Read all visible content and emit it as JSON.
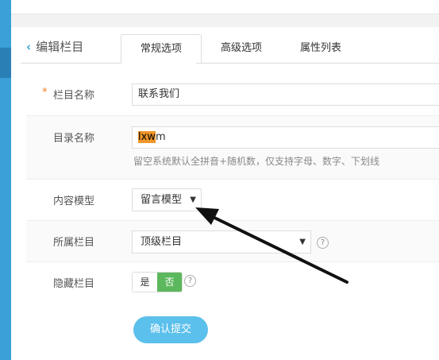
{
  "header": {
    "back_label": "编辑栏目"
  },
  "tabs": [
    {
      "label": "常规选项"
    },
    {
      "label": "高级选项"
    },
    {
      "label": "属性列表"
    }
  ],
  "form": {
    "column_name": {
      "label": "栏目名称",
      "required_mark": "*",
      "value": "联系我们"
    },
    "directory_name": {
      "label": "目录名称",
      "value_selected": "lxw",
      "value_rest": "m",
      "hint": "留空系统默认全拼音+随机数，仅支持字母、数字、下划线"
    },
    "content_model": {
      "label": "内容模型",
      "value": "留言模型"
    },
    "parent_column": {
      "label": "所属栏目",
      "value": "顶级栏目"
    },
    "hidden_column": {
      "label": "隐藏栏目",
      "yes": "是",
      "no": "否",
      "selected": "否"
    },
    "submit_label": "确认提交"
  },
  "icons": {
    "back": "chevron-left-icon",
    "help": "question-circle-icon",
    "caret": "caret-down-icon",
    "annotation": "arrow-annotation"
  },
  "colors": {
    "accent": "#3b9fd8",
    "toggle_active": "#5cb85c",
    "submit_button": "#5bc0eb",
    "required_mark": "#f07f1e",
    "text_highlight": "#f0962a"
  }
}
